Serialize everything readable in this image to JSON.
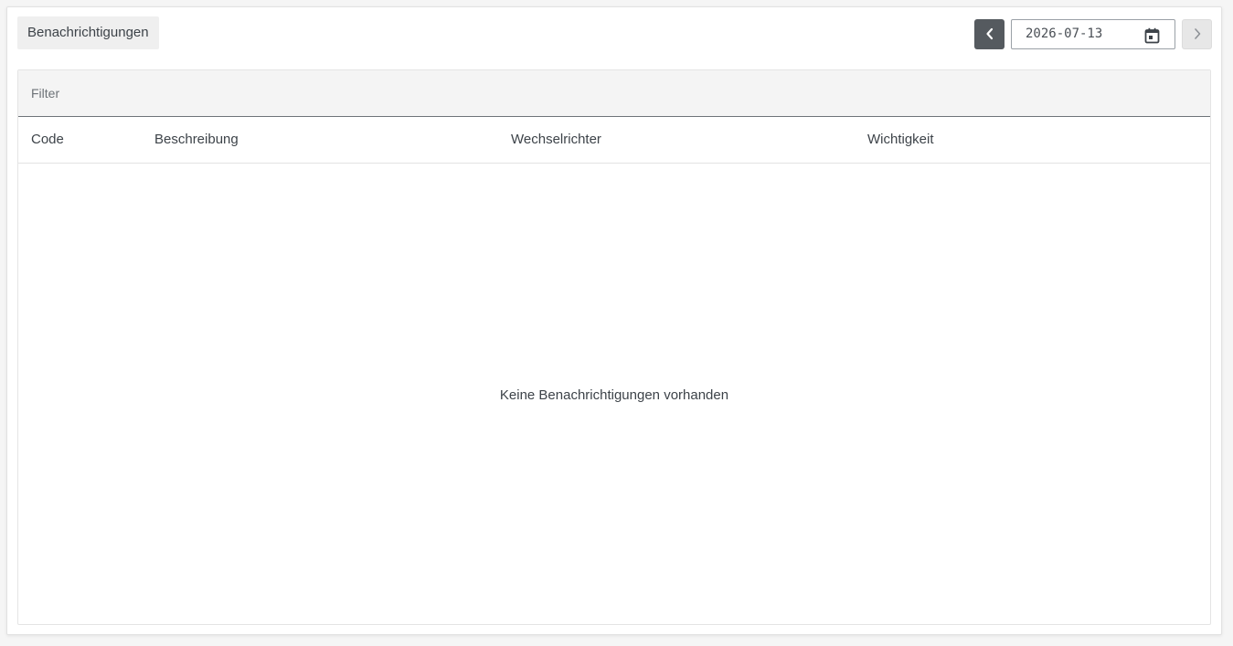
{
  "header": {
    "title": "Benachrichtigungen"
  },
  "date_nav": {
    "prev_icon": "chevron-left-icon",
    "date_value": "2026-07-13",
    "calendar_icon": "calendar-icon",
    "next_icon": "chevron-right-icon"
  },
  "filter": {
    "placeholder": "Filter"
  },
  "table": {
    "columns": [
      "Code",
      "Beschreibung",
      "Wechselrichter",
      "Wichtigkeit"
    ],
    "rows": [],
    "empty_message": "Keine Benachrichtigungen vorhanden"
  },
  "colors": {
    "prev_button_bg": "#555a5f",
    "next_button_bg": "#e7e7e7",
    "title_tab_bg": "#efefef",
    "filter_bg": "#f4f4f4",
    "text": "#3d4349"
  }
}
